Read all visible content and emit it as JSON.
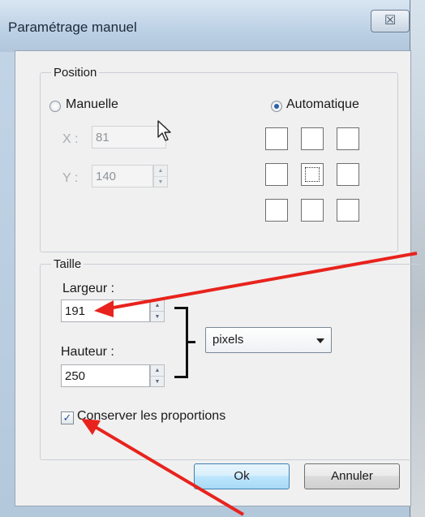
{
  "dialog": {
    "title": "Paramétrage manuel",
    "close_label": "☒"
  },
  "position": {
    "group_title": "Position",
    "manual_label": "Manuelle",
    "auto_label": "Automatique",
    "mode": "Automatique",
    "x_label": "X :",
    "x_value": "81",
    "y_label": "Y :",
    "y_value": "140",
    "grid_selected": "center"
  },
  "size": {
    "group_title": "Taille",
    "width_label": "Largeur :",
    "width_value": "191",
    "height_label": "Hauteur :",
    "height_value": "250",
    "unit": "pixels",
    "keep_ratio_label": "Conserver les proportions",
    "keep_ratio_checked": true
  },
  "buttons": {
    "ok_label": "Ok",
    "cancel_label": "Annuler"
  },
  "colors": {
    "annotation_arrow": "#e8231d",
    "dialog_frame": "#b4c8dc",
    "client_bg": "#f0f0f0"
  },
  "icons": {
    "spin_up": "▲",
    "spin_down": "▼",
    "check": "✓"
  }
}
